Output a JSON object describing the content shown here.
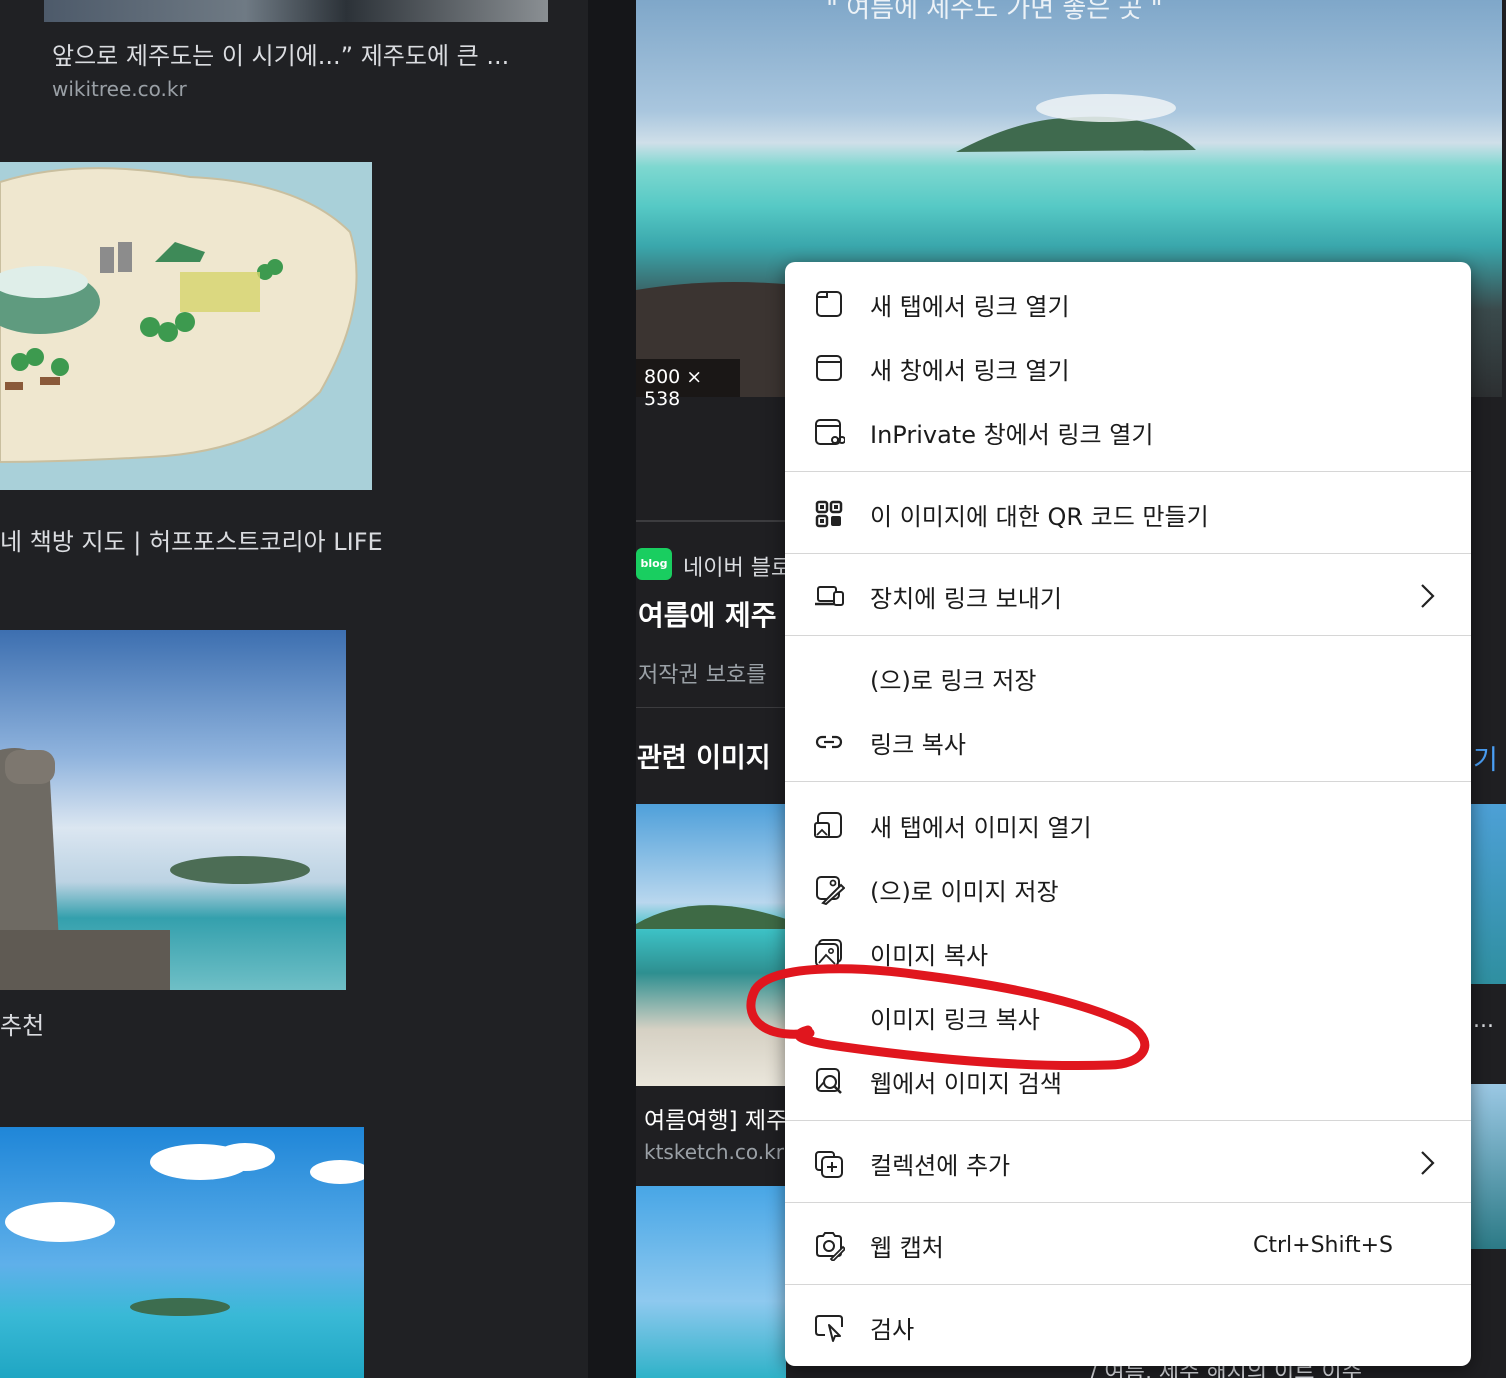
{
  "left": {
    "item1_caption": "앞으로 제주도는 이 시기에...” 제주도에 큰 ...",
    "item1_source": "wikitree.co.kr",
    "item2_caption": "네 책방 지도 | 허프포스트코리아 LIFE",
    "item3_caption": "추천"
  },
  "detail": {
    "top_banner": "\" 여름에 제주도 가면 좋은 곳 \"",
    "dimensions": "800 × 538",
    "source_name": "네이버 블로그",
    "title": "여름에 제주",
    "copyright": "저작권 보호를",
    "related_heading": "관련 이미지",
    "related_more": "기",
    "related1_caption": "여름여행] 제주",
    "related1_source": "ktsketch.co.kr",
    "related2_ellipsis": "...",
    "bottom_caption": "/ 여름, 제주 해지의 이르 이주"
  },
  "context_menu": {
    "items": [
      {
        "icon": "new-tab-icon",
        "label": "새 탭에서 링크 열기"
      },
      {
        "icon": "new-window-icon",
        "label": "새 창에서 링크 열기"
      },
      {
        "icon": "inprivate-window-icon",
        "label": "InPrivate 창에서 링크 열기"
      },
      {
        "icon": "qr-code-icon",
        "label": "이 이미지에 대한 QR 코드 만들기"
      },
      {
        "icon": "send-to-device-icon",
        "label": "장치에 링크 보내기"
      },
      {
        "icon": "",
        "label": "(으)로 링크 저장"
      },
      {
        "icon": "link-icon",
        "label": "링크 복사"
      },
      {
        "icon": "open-image-icon",
        "label": "새 탭에서 이미지 열기"
      },
      {
        "icon": "save-image-icon",
        "label": "(으)로 이미지 저장"
      },
      {
        "icon": "copy-image-icon",
        "label": "이미지 복사"
      },
      {
        "icon": "",
        "label": "이미지 링크 복사"
      },
      {
        "icon": "visual-search-icon",
        "label": "웹에서 이미지 검색"
      },
      {
        "icon": "add-collection-icon",
        "label": "컬렉션에 추가"
      },
      {
        "icon": "web-capture-icon",
        "label": "웹 캡처",
        "shortcut": "Ctrl+Shift+S"
      },
      {
        "icon": "inspect-icon",
        "label": "검사"
      }
    ]
  },
  "colors": {
    "page_bg": "#202124",
    "menu_bg": "#ffffff",
    "annotation": "#e0161e"
  }
}
